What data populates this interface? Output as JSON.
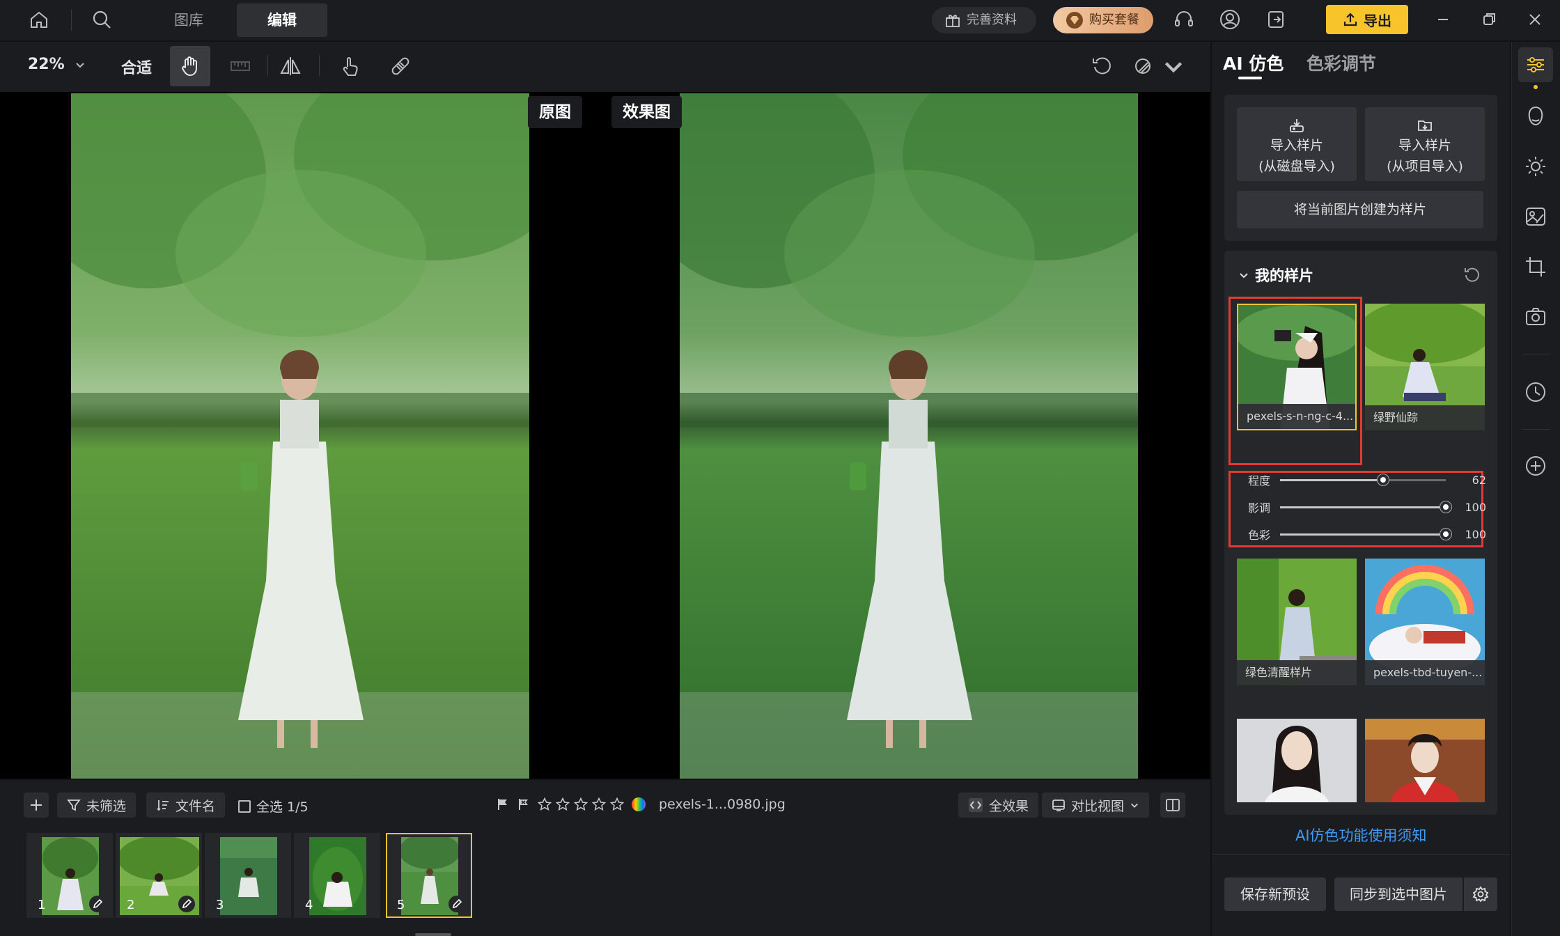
{
  "topbar": {
    "tabs": [
      {
        "label": "图库"
      },
      {
        "label": "编辑"
      }
    ],
    "profile_label": "完善资料",
    "buy_label": "购买套餐",
    "export_label": "导出"
  },
  "toolbar": {
    "zoom": "22%",
    "fit_label": "合适"
  },
  "canvas": {
    "original_label": "原图",
    "effect_label": "效果图"
  },
  "bottom": {
    "filter_label": "未筛选",
    "sort_label": "文件名",
    "select_all_label": "全选 1/5",
    "filename": "pexels-1...0980.jpg",
    "all_effects_label": "全效果",
    "compare_label": "对比视图",
    "rating": 0,
    "thumbnails": [
      {
        "num": "1"
      },
      {
        "num": "2"
      },
      {
        "num": "3"
      },
      {
        "num": "4"
      },
      {
        "num": "5"
      }
    ]
  },
  "panel": {
    "tab_ai": "AI 仿色",
    "tab_color": "色彩调节",
    "import_disk_line1": "导入样片",
    "import_disk_line2": "(从磁盘导入)",
    "import_project_line1": "导入样片",
    "import_project_line2": "(从项目导入)",
    "create_sample": "将当前图片创建为样片",
    "my_samples": "我的样片",
    "samples": [
      {
        "caption": "pexels-s-n-ng-c-4..."
      },
      {
        "caption": "绿野仙踪"
      },
      {
        "caption": "绿色清醒样片"
      },
      {
        "caption": "pexels-tbd-tuyen-..."
      },
      {
        "caption": ""
      },
      {
        "caption": ""
      }
    ],
    "sliders": [
      {
        "label": "程度",
        "value": "62",
        "fraction": 0.62
      },
      {
        "label": "影调",
        "value": "100",
        "fraction": 1.0
      },
      {
        "label": "色彩",
        "value": "100",
        "fraction": 1.0
      }
    ],
    "ai_notice": "AI仿色功能使用须知",
    "save_preset": "保存新预设",
    "sync": "同步到选中图片"
  },
  "colors": {
    "accent": "#f8c42b",
    "highlight": "#e53935",
    "link": "#3d9bff"
  }
}
